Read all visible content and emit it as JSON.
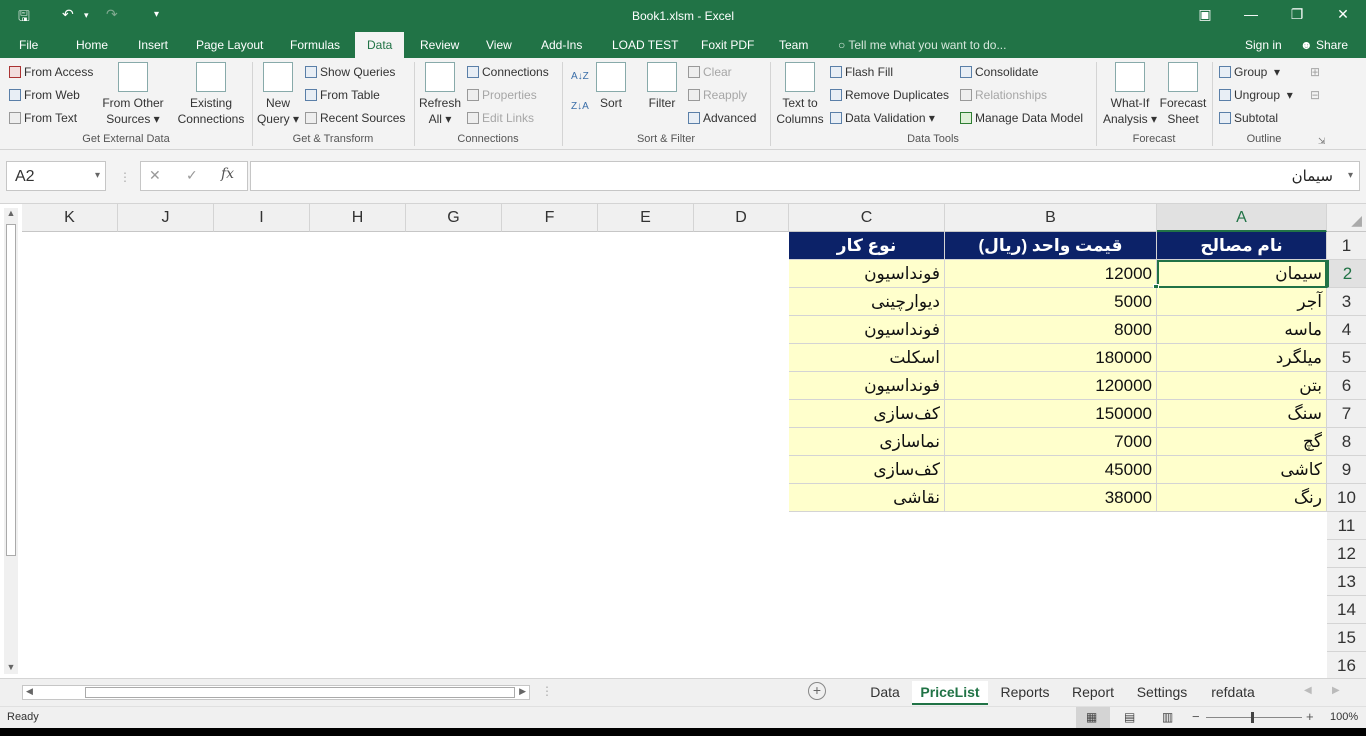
{
  "window": {
    "title": "Book1.xlsm - Excel"
  },
  "ribbon_tabs": [
    {
      "label": "File"
    },
    {
      "label": "Home"
    },
    {
      "label": "Insert"
    },
    {
      "label": "Page Layout"
    },
    {
      "label": "Formulas"
    },
    {
      "label": "Data"
    },
    {
      "label": "Review"
    },
    {
      "label": "View"
    },
    {
      "label": "Add-Ins"
    },
    {
      "label": "LOAD TEST"
    },
    {
      "label": "Foxit PDF"
    },
    {
      "label": "Team"
    }
  ],
  "tell_me": "Tell me what you want to do...",
  "account": {
    "signin": "Sign in",
    "share": "Share"
  },
  "groups": {
    "get_external": {
      "name": "Get External Data",
      "from_access": "From Access",
      "from_web": "From Web",
      "from_text": "From Text",
      "from_other_1": "From Other",
      "from_other_2": "Sources",
      "existing_1": "Existing",
      "existing_2": "Connections"
    },
    "get_transform": {
      "name": "Get & Transform",
      "new_query_1": "New",
      "new_query_2": "Query",
      "show_queries": "Show Queries",
      "from_table": "From Table",
      "recent_sources": "Recent Sources"
    },
    "connections": {
      "name": "Connections",
      "refresh_1": "Refresh",
      "refresh_2": "All",
      "connections": "Connections",
      "properties": "Properties",
      "edit_links": "Edit Links"
    },
    "sort_filter": {
      "name": "Sort & Filter",
      "sort": "Sort",
      "filter": "Filter",
      "clear": "Clear",
      "reapply": "Reapply",
      "advanced": "Advanced"
    },
    "data_tools": {
      "name": "Data Tools",
      "text_to_1": "Text to",
      "text_to_2": "Columns",
      "flash_fill": "Flash Fill",
      "remove_duplicates": "Remove Duplicates",
      "data_validation": "Data Validation",
      "consolidate": "Consolidate",
      "relationships": "Relationships",
      "manage_model": "Manage Data Model"
    },
    "forecast": {
      "name": "Forecast",
      "whatif_1": "What-If",
      "whatif_2": "Analysis",
      "forecast_1": "Forecast",
      "forecast_2": "Sheet"
    },
    "outline": {
      "name": "Outline",
      "group": "Group",
      "ungroup": "Ungroup",
      "subtotal": "Subtotal"
    }
  },
  "formula_bar": {
    "name_box": "A2",
    "fx": "fx",
    "value": "سیمان"
  },
  "columns": [
    "K",
    "J",
    "I",
    "H",
    "G",
    "F",
    "E",
    "D",
    "C",
    "B",
    "A"
  ],
  "rows": [
    "1",
    "2",
    "3",
    "4",
    "5",
    "6",
    "7",
    "8",
    "9",
    "10",
    "11",
    "12",
    "13",
    "14",
    "15",
    "16"
  ],
  "table": {
    "headers": [
      "نام مصالح",
      "قیمت واحد (ریال)",
      "نوع کار"
    ],
    "rows": [
      {
        "material": "سیمان",
        "price": "12000",
        "work": "فونداسیون"
      },
      {
        "material": "آجر",
        "price": "5000",
        "work": "دیوارچینی"
      },
      {
        "material": "ماسه",
        "price": "8000",
        "work": "فونداسیون"
      },
      {
        "material": "میلگرد",
        "price": "180000",
        "work": "اسکلت"
      },
      {
        "material": "بتن",
        "price": "120000",
        "work": "فونداسیون"
      },
      {
        "material": "سنگ",
        "price": "150000",
        "work": "کف‌سازی"
      },
      {
        "material": "گچ",
        "price": "7000",
        "work": "نماسازی"
      },
      {
        "material": "کاشی",
        "price": "45000",
        "work": "کف‌سازی"
      },
      {
        "material": "رنگ",
        "price": "38000",
        "work": "نقاشی"
      }
    ]
  },
  "sheet_tabs": [
    "Data",
    "PriceList",
    "Reports",
    "Report",
    "Settings",
    "refdata"
  ],
  "status": {
    "ready": "Ready",
    "zoom": "100%"
  },
  "colors": {
    "excel_green": "#217346",
    "header_fill": "#0c2268",
    "data_fill": "#ffffcc"
  }
}
